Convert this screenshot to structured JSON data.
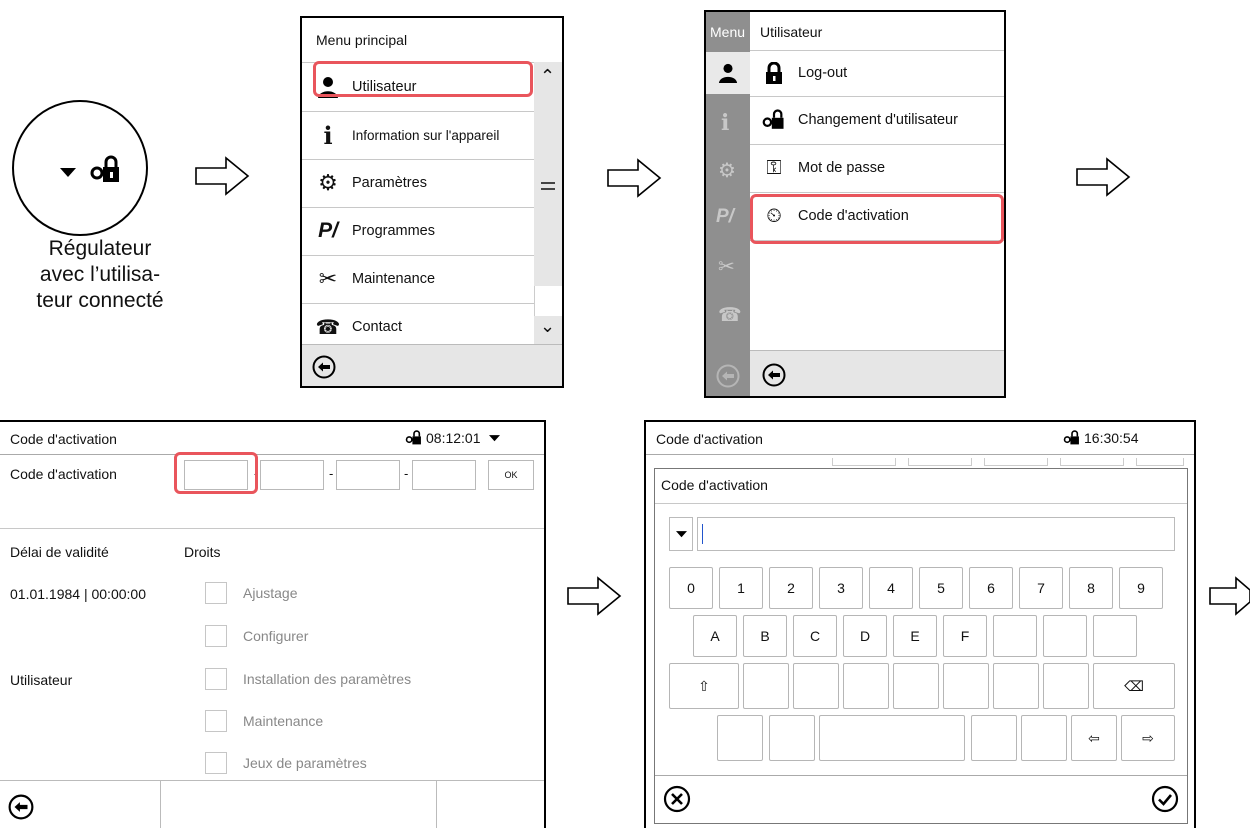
{
  "panel1": {
    "caption_line1": "Régulateur",
    "caption_line2": "avec l’utilisa-",
    "caption_line3": "teur connecté"
  },
  "panel2": {
    "title": "Menu principal",
    "items": [
      {
        "label": "Utilisateur",
        "icon": "user-icon"
      },
      {
        "label": "Information sur l'appareil",
        "icon": "info-icon"
      },
      {
        "label": "Paramètres",
        "icon": "gears-icon"
      },
      {
        "label": "Programmes",
        "icon": "programs-icon"
      },
      {
        "label": "Maintenance",
        "icon": "tools-icon"
      },
      {
        "label": "Contact",
        "icon": "phone-icon"
      }
    ]
  },
  "panel3": {
    "side_label": "Menu",
    "title": "Utilisateur",
    "items": [
      {
        "label": "Log-out",
        "icon": "lock-icon"
      },
      {
        "label": "Changement d'utilisateur",
        "icon": "user-change-icon"
      },
      {
        "label": "Mot de passe",
        "icon": "password-icon"
      },
      {
        "label": "Code d'activation",
        "icon": "activation-code-icon"
      }
    ]
  },
  "panel4": {
    "title": "Code d'activation",
    "time": "08:12:01",
    "code_label": "Code d'activation",
    "dash": "-",
    "ok": "OK",
    "validity_label": "Délai de validité",
    "validity_value": "01.01.1984 | 00:00:00",
    "rights_label": "Droits",
    "user_label": "Utilisateur",
    "rights": [
      "Ajustage",
      "Configurer",
      "Installation des paramètres",
      "Maintenance",
      "Jeux de paramètres"
    ]
  },
  "panel5": {
    "title": "Code d'activation",
    "time": "16:30:54",
    "dialog_title": "Code d'activation",
    "digits": [
      "0",
      "1",
      "2",
      "3",
      "4",
      "5",
      "6",
      "7",
      "8",
      "9"
    ],
    "letters": [
      "A",
      "B",
      "C",
      "D",
      "E",
      "F"
    ],
    "shift": "⇧",
    "backspace": "⌫",
    "left": "⇦",
    "right": "⇨"
  },
  "colors": {
    "highlight": "#e9555c",
    "sidebar": "#8f8f8f",
    "footer": "#e6e6e6"
  }
}
